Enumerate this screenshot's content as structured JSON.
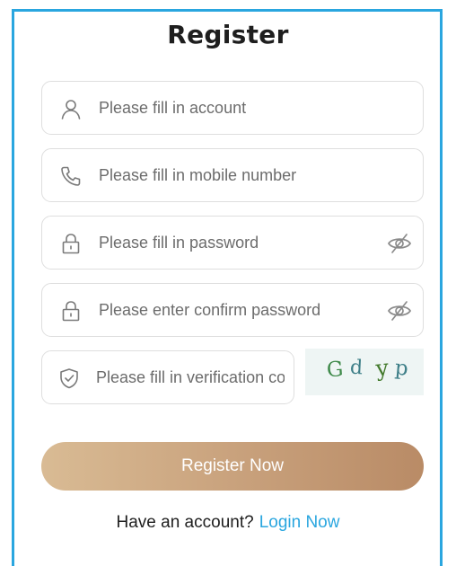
{
  "form": {
    "title": "Register",
    "account": {
      "placeholder": "Please fill in account",
      "icon": "user-icon"
    },
    "mobile": {
      "placeholder": "Please fill in mobile number",
      "icon": "phone-icon"
    },
    "password": {
      "placeholder": "Please fill in password",
      "icon": "lock-icon",
      "toggle_icon": "eye-slash-icon"
    },
    "confirm_password": {
      "placeholder": "Please enter confirm password",
      "icon": "lock-icon",
      "toggle_icon": "eye-slash-icon"
    },
    "verification": {
      "placeholder": "Please fill in verification code",
      "icon": "shield-check-icon"
    },
    "captcha": {
      "text": "Gd yp",
      "chars": [
        "G",
        "d",
        "y",
        "p"
      ],
      "colors": [
        "#3f8a4a",
        "#3e7f88",
        "#437a2c",
        "#3e7f88"
      ]
    },
    "register_button": "Register Now",
    "footer": {
      "prompt": "Have an account?",
      "login_link": "Login Now"
    }
  },
  "colors": {
    "accent": "#2aa6df",
    "button_gradient_start": "#d9bb94",
    "button_gradient_end": "#b98b66",
    "placeholder": "#6c6c6c",
    "captcha_background": "#eef5f4"
  }
}
